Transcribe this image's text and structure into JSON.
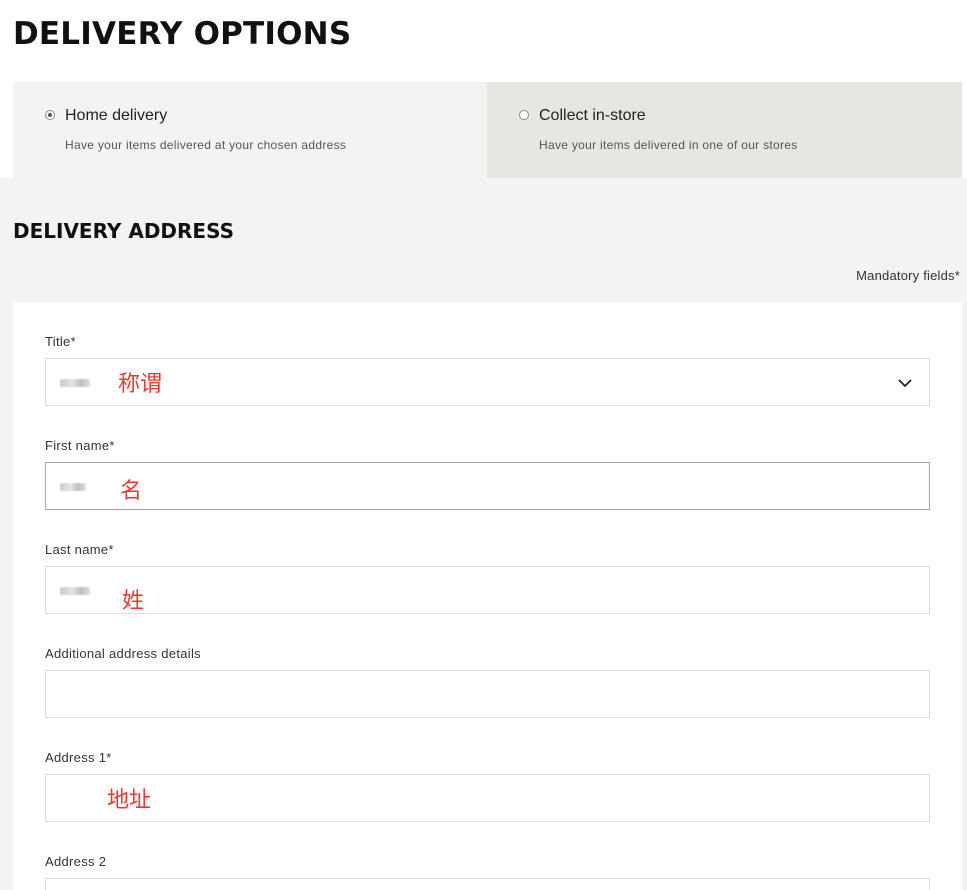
{
  "page": {
    "title": "DELIVERY OPTIONS"
  },
  "delivery_options": [
    {
      "label": "Home delivery",
      "description": "Have your items delivered at your chosen address",
      "selected": true
    },
    {
      "label": "Collect in-store",
      "description": "Have your items delivered in one of our stores",
      "selected": false
    }
  ],
  "address_section": {
    "title": "DELIVERY ADDRESS",
    "mandatory_note": "Mandatory fields*"
  },
  "form": {
    "title": {
      "label": "Title*",
      "annotation": "称谓",
      "icon": "chevron-down-icon"
    },
    "first_name": {
      "label": "First name*",
      "annotation": "名"
    },
    "last_name": {
      "label": "Last name*",
      "annotation": "姓"
    },
    "additional": {
      "label": "Additional address details"
    },
    "address1": {
      "label": "Address 1*",
      "annotation": "地址"
    },
    "address2": {
      "label": "Address 2"
    }
  },
  "colors": {
    "annotation_red": "#e53935",
    "band_bg": "#f4f3f1",
    "unselected_option_bg": "#e8e6e2"
  }
}
